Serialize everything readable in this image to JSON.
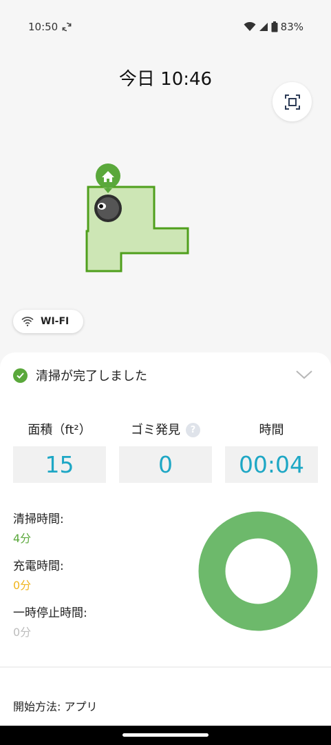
{
  "status_bar": {
    "time": "10:50",
    "battery": "83%",
    "icons": [
      "sync-icon",
      "wifi-icon",
      "signal-icon",
      "battery-icon"
    ]
  },
  "header": {
    "title": "今日 10:46",
    "fit_icon": "fit-screen-icon"
  },
  "map": {
    "fill_color": "#cde6b5",
    "border_color": "#4f9f1c",
    "dock_icon": "home-icon"
  },
  "connection": {
    "label": "WI-FI",
    "icon": "wifi-icon"
  },
  "summary": {
    "status_text": "清掃が完了しました",
    "status_icon": "check-icon",
    "status_color": "#5aa83b"
  },
  "stats": [
    {
      "label": "面積（ft²）",
      "value": "15"
    },
    {
      "label": "ゴミ発見",
      "value": "0",
      "help": "?"
    },
    {
      "label": "時間",
      "value": "00:04"
    }
  ],
  "times": {
    "cleaning_label": "清掃時間:",
    "cleaning_value": "4分",
    "cleaning_color": "#5aa83b",
    "charging_label": "充電時間:",
    "charging_value": "0分",
    "charging_color": "#f0b51d",
    "paused_label": "一時停止時間:",
    "paused_value": "0分",
    "paused_color": "#bdbdbd"
  },
  "donut": {
    "color": "#6db96b",
    "cleaning_fraction": 1.0
  },
  "start_method": "開始方法: アプリ"
}
